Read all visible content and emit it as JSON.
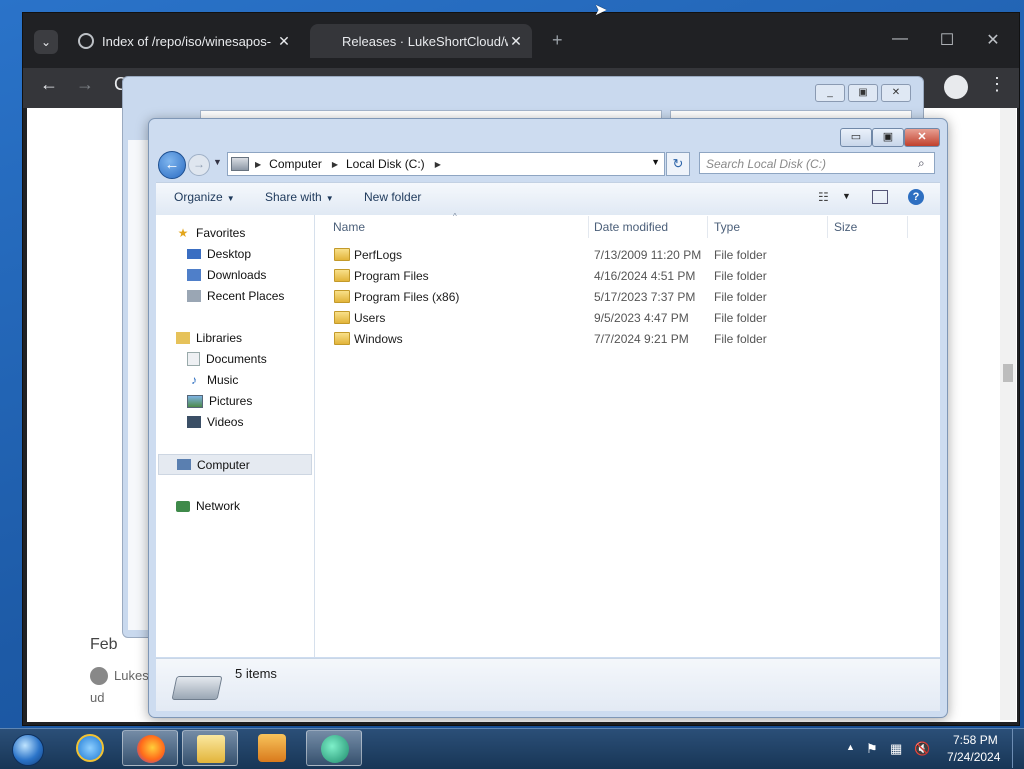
{
  "browser": {
    "tabs": [
      {
        "title": "Index of /repo/iso/winesapos-",
        "close": "✕"
      },
      {
        "title": "Releases · LukeShortCloud/wi",
        "close": "✕"
      }
    ],
    "new_tab": "+",
    "nav": {
      "back": "←",
      "forward": "→",
      "reload": "C"
    },
    "window_controls": {
      "minimize": "—",
      "maximize": "☐",
      "close": "✕"
    },
    "menu": "⋮",
    "page_fragments": {
      "feb": "Feb",
      "user": "Lukes",
      "ud": "ud"
    }
  },
  "explorer": {
    "window_controls": {
      "minimize": "▭",
      "maximize": "▣",
      "close": "✕"
    },
    "address": [
      "Computer",
      "Local Disk (C:)"
    ],
    "search_placeholder": "Search Local Disk (C:)",
    "toolbar": {
      "organize": "Organize",
      "share_with": "Share with",
      "new_folder": "New folder"
    },
    "nav": {
      "favorites": "Favorites",
      "desktop": "Desktop",
      "downloads": "Downloads",
      "recent_places": "Recent Places",
      "libraries": "Libraries",
      "documents": "Documents",
      "music": "Music",
      "pictures": "Pictures",
      "videos": "Videos",
      "computer": "Computer",
      "network": "Network"
    },
    "columns": {
      "name": "Name",
      "date": "Date modified",
      "type": "Type",
      "size": "Size"
    },
    "files": [
      {
        "name": "PerfLogs",
        "date": "7/13/2009 11:20 PM",
        "type": "File folder"
      },
      {
        "name": "Program Files",
        "date": "4/16/2024 4:51 PM",
        "type": "File folder"
      },
      {
        "name": "Program Files (x86)",
        "date": "5/17/2023 7:37 PM",
        "type": "File folder"
      },
      {
        "name": "Users",
        "date": "9/5/2023 4:47 PM",
        "type": "File folder"
      },
      {
        "name": "Windows",
        "date": "7/7/2024 9:21 PM",
        "type": "File folder"
      }
    ],
    "status": "5 items"
  },
  "taskbar": {
    "clock_time": "7:58 PM",
    "clock_date": "7/24/2024"
  },
  "colors": {
    "accent": "#2e6fc1",
    "folder": "#e2b43a",
    "chrome_bg": "#202124"
  }
}
